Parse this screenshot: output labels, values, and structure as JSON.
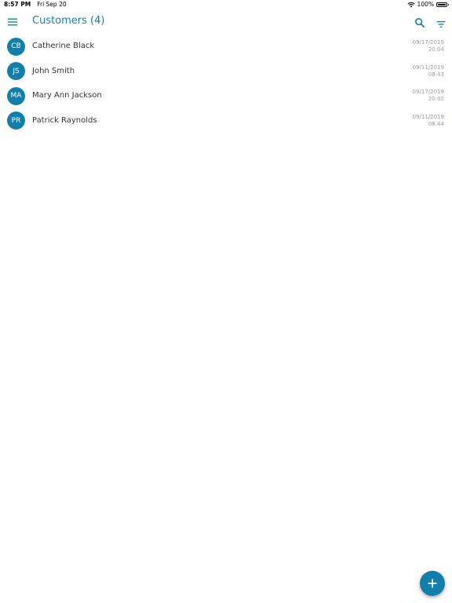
{
  "status_bar": {
    "time": "8:57 PM",
    "date": "Fri Sep 20",
    "battery_text": "100%",
    "battery_level": 1.0
  },
  "header": {
    "title": "Customers (4)",
    "icons": {
      "menu": "menu-icon",
      "search": "search-icon",
      "filter": "filter-icon"
    }
  },
  "customers": [
    {
      "initials": "CB",
      "name": "Catherine Black",
      "date": "09/17/2019",
      "time": "20:04"
    },
    {
      "initials": "JS",
      "name": "John Smith",
      "date": "09/11/2019",
      "time": "08:43"
    },
    {
      "initials": "MA",
      "name": "Mary Ann Jackson",
      "date": "09/17/2019",
      "time": "20:02"
    },
    {
      "initials": "PR",
      "name": "Patrick Raynolds",
      "date": "09/11/2019",
      "time": "08:44"
    }
  ],
  "fab": {
    "icon": "plus-icon"
  },
  "colors": {
    "accent": "#1183ac",
    "avatar_bg": "#127fab",
    "muted_text": "#9aa0a6"
  }
}
